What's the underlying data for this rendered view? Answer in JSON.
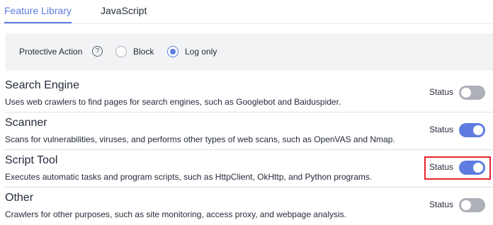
{
  "tabs": [
    {
      "label": "Feature Library",
      "active": true
    },
    {
      "label": "JavaScript",
      "active": false
    }
  ],
  "protective_action": {
    "label": "Protective Action",
    "help_icon": "question-circle-icon",
    "options": [
      {
        "label": "Block",
        "selected": false
      },
      {
        "label": "Log only",
        "selected": true
      }
    ]
  },
  "features": [
    {
      "title": "Search Engine",
      "description": "Uses web crawlers to find pages for search engines, such as Googlebot and Baiduspider.",
      "status_label": "Status",
      "enabled": false
    },
    {
      "title": "Scanner",
      "description": "Scans for vulnerabilities, viruses, and performs other types of web scans, such as OpenVAS and Nmap.",
      "status_label": "Status",
      "enabled": true
    },
    {
      "title": "Script Tool",
      "description": "Executes automatic tasks and program scripts, such as HttpClient, OkHttp, and Python programs.",
      "status_label": "Status",
      "enabled": true,
      "highlighted": true
    },
    {
      "title": "Other",
      "description": "Crawlers for other purposes, such as site monitoring, access proxy, and webpage analysis.",
      "status_label": "Status",
      "enabled": false
    }
  ],
  "colors": {
    "accent": "#5e7ce0",
    "highlight": "#e3262a",
    "toggle_off": "#adb0b8"
  }
}
